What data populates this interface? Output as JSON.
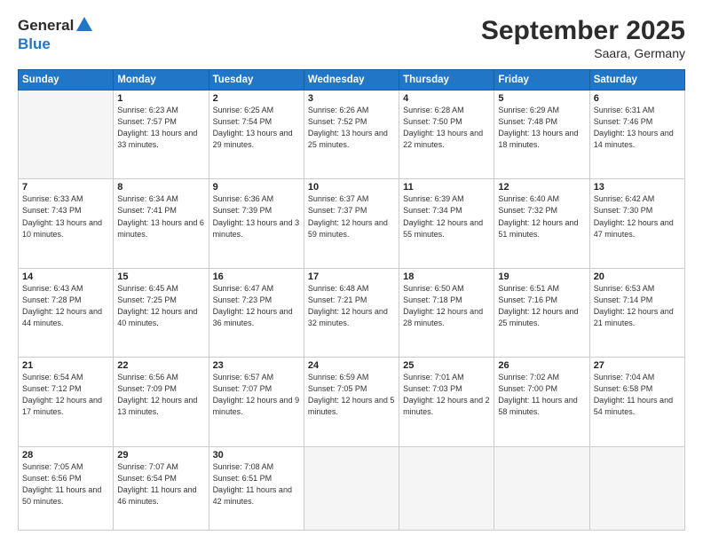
{
  "header": {
    "logo_line1": "General",
    "logo_line2": "Blue",
    "month": "September 2025",
    "location": "Saara, Germany"
  },
  "weekdays": [
    "Sunday",
    "Monday",
    "Tuesday",
    "Wednesday",
    "Thursday",
    "Friday",
    "Saturday"
  ],
  "weeks": [
    [
      {
        "day": "",
        "sunrise": "",
        "sunset": "",
        "daylight": "",
        "empty": true
      },
      {
        "day": "1",
        "sunrise": "6:23 AM",
        "sunset": "7:57 PM",
        "daylight": "13 hours and 33 minutes."
      },
      {
        "day": "2",
        "sunrise": "6:25 AM",
        "sunset": "7:54 PM",
        "daylight": "13 hours and 29 minutes."
      },
      {
        "day": "3",
        "sunrise": "6:26 AM",
        "sunset": "7:52 PM",
        "daylight": "13 hours and 25 minutes."
      },
      {
        "day": "4",
        "sunrise": "6:28 AM",
        "sunset": "7:50 PM",
        "daylight": "13 hours and 22 minutes."
      },
      {
        "day": "5",
        "sunrise": "6:29 AM",
        "sunset": "7:48 PM",
        "daylight": "13 hours and 18 minutes."
      },
      {
        "day": "6",
        "sunrise": "6:31 AM",
        "sunset": "7:46 PM",
        "daylight": "13 hours and 14 minutes."
      }
    ],
    [
      {
        "day": "7",
        "sunrise": "6:33 AM",
        "sunset": "7:43 PM",
        "daylight": "13 hours and 10 minutes."
      },
      {
        "day": "8",
        "sunrise": "6:34 AM",
        "sunset": "7:41 PM",
        "daylight": "13 hours and 6 minutes."
      },
      {
        "day": "9",
        "sunrise": "6:36 AM",
        "sunset": "7:39 PM",
        "daylight": "13 hours and 3 minutes."
      },
      {
        "day": "10",
        "sunrise": "6:37 AM",
        "sunset": "7:37 PM",
        "daylight": "12 hours and 59 minutes."
      },
      {
        "day": "11",
        "sunrise": "6:39 AM",
        "sunset": "7:34 PM",
        "daylight": "12 hours and 55 minutes."
      },
      {
        "day": "12",
        "sunrise": "6:40 AM",
        "sunset": "7:32 PM",
        "daylight": "12 hours and 51 minutes."
      },
      {
        "day": "13",
        "sunrise": "6:42 AM",
        "sunset": "7:30 PM",
        "daylight": "12 hours and 47 minutes."
      }
    ],
    [
      {
        "day": "14",
        "sunrise": "6:43 AM",
        "sunset": "7:28 PM",
        "daylight": "12 hours and 44 minutes."
      },
      {
        "day": "15",
        "sunrise": "6:45 AM",
        "sunset": "7:25 PM",
        "daylight": "12 hours and 40 minutes."
      },
      {
        "day": "16",
        "sunrise": "6:47 AM",
        "sunset": "7:23 PM",
        "daylight": "12 hours and 36 minutes."
      },
      {
        "day": "17",
        "sunrise": "6:48 AM",
        "sunset": "7:21 PM",
        "daylight": "12 hours and 32 minutes."
      },
      {
        "day": "18",
        "sunrise": "6:50 AM",
        "sunset": "7:18 PM",
        "daylight": "12 hours and 28 minutes."
      },
      {
        "day": "19",
        "sunrise": "6:51 AM",
        "sunset": "7:16 PM",
        "daylight": "12 hours and 25 minutes."
      },
      {
        "day": "20",
        "sunrise": "6:53 AM",
        "sunset": "7:14 PM",
        "daylight": "12 hours and 21 minutes."
      }
    ],
    [
      {
        "day": "21",
        "sunrise": "6:54 AM",
        "sunset": "7:12 PM",
        "daylight": "12 hours and 17 minutes."
      },
      {
        "day": "22",
        "sunrise": "6:56 AM",
        "sunset": "7:09 PM",
        "daylight": "12 hours and 13 minutes."
      },
      {
        "day": "23",
        "sunrise": "6:57 AM",
        "sunset": "7:07 PM",
        "daylight": "12 hours and 9 minutes."
      },
      {
        "day": "24",
        "sunrise": "6:59 AM",
        "sunset": "7:05 PM",
        "daylight": "12 hours and 5 minutes."
      },
      {
        "day": "25",
        "sunrise": "7:01 AM",
        "sunset": "7:03 PM",
        "daylight": "12 hours and 2 minutes."
      },
      {
        "day": "26",
        "sunrise": "7:02 AM",
        "sunset": "7:00 PM",
        "daylight": "11 hours and 58 minutes."
      },
      {
        "day": "27",
        "sunrise": "7:04 AM",
        "sunset": "6:58 PM",
        "daylight": "11 hours and 54 minutes."
      }
    ],
    [
      {
        "day": "28",
        "sunrise": "7:05 AM",
        "sunset": "6:56 PM",
        "daylight": "11 hours and 50 minutes."
      },
      {
        "day": "29",
        "sunrise": "7:07 AM",
        "sunset": "6:54 PM",
        "daylight": "11 hours and 46 minutes."
      },
      {
        "day": "30",
        "sunrise": "7:08 AM",
        "sunset": "6:51 PM",
        "daylight": "11 hours and 42 minutes."
      },
      {
        "day": "",
        "sunrise": "",
        "sunset": "",
        "daylight": "",
        "empty": true
      },
      {
        "day": "",
        "sunrise": "",
        "sunset": "",
        "daylight": "",
        "empty": true
      },
      {
        "day": "",
        "sunrise": "",
        "sunset": "",
        "daylight": "",
        "empty": true
      },
      {
        "day": "",
        "sunrise": "",
        "sunset": "",
        "daylight": "",
        "empty": true
      }
    ]
  ]
}
